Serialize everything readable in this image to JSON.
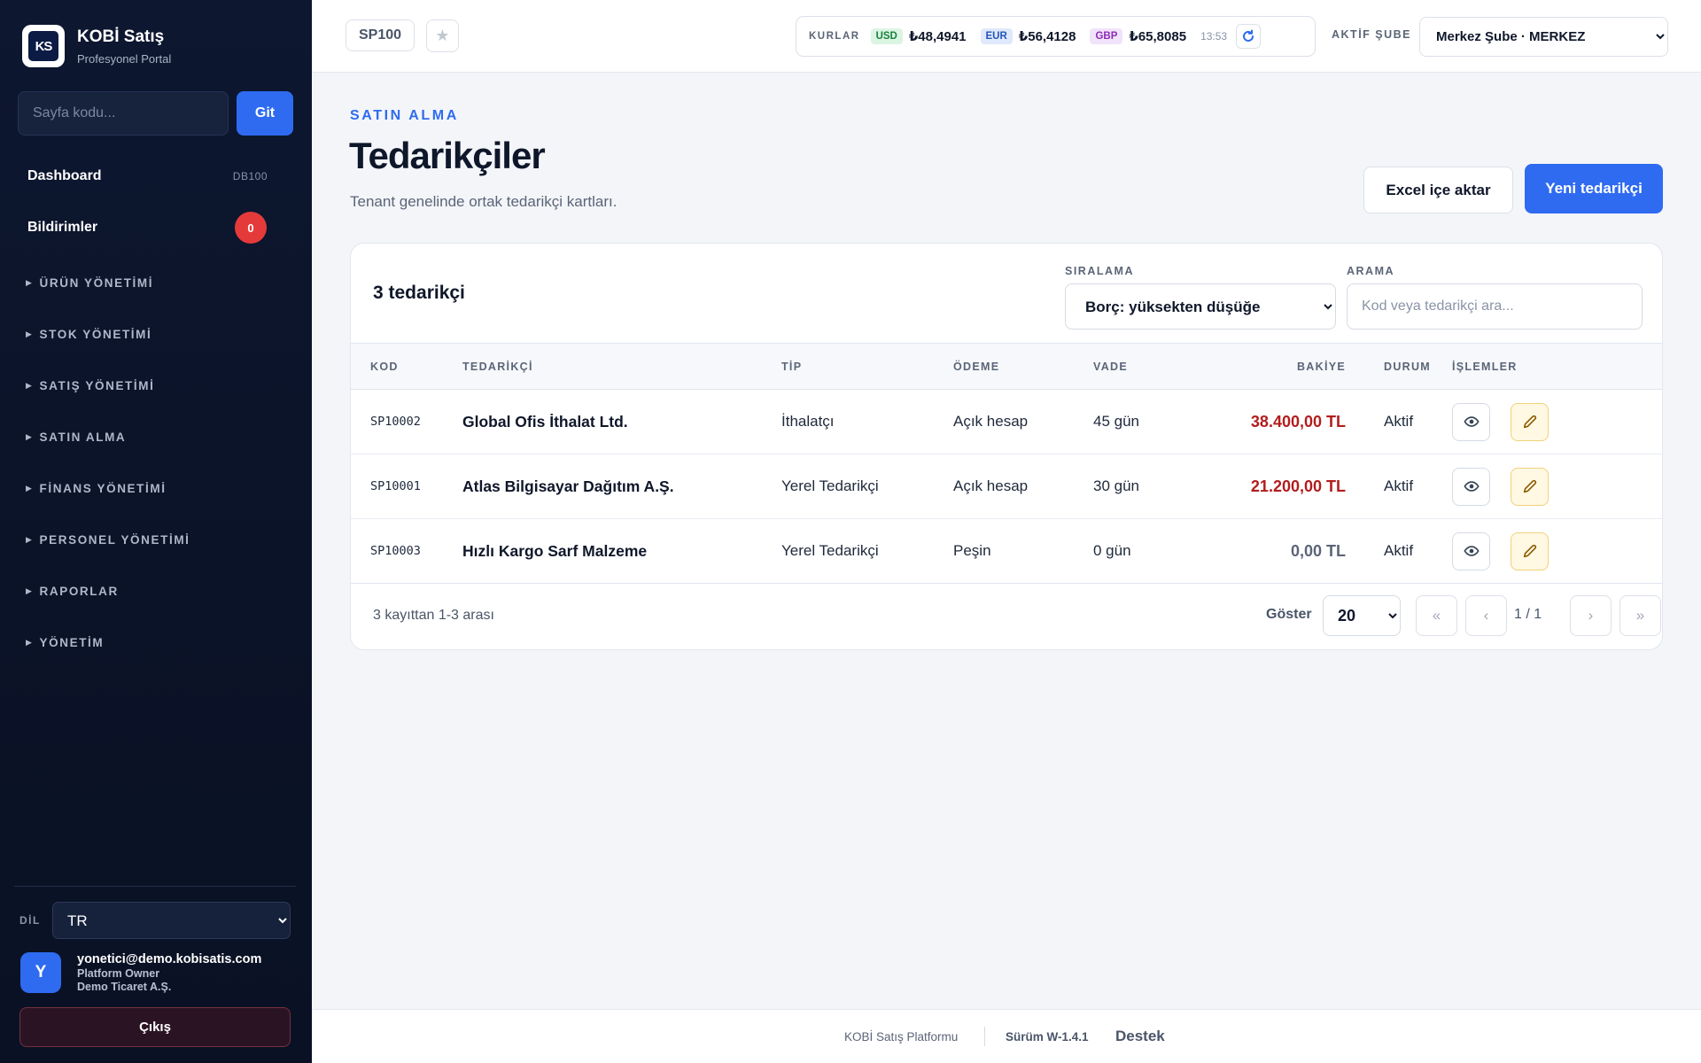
{
  "brand": {
    "logo_text": "KS",
    "title": "KOBİ Satış",
    "subtitle": "Profesyonel Portal"
  },
  "page_jump": {
    "placeholder": "Sayfa kodu...",
    "button": "Git"
  },
  "nav": {
    "dashboard": {
      "label": "Dashboard",
      "code": "DB100"
    },
    "notifications": {
      "label": "Bildirimler",
      "count": "0"
    },
    "groups": [
      "ÜRÜN YÖNETİMİ",
      "STOK YÖNETİMİ",
      "SATIŞ YÖNETİMİ",
      "SATIN ALMA",
      "FİNANS YÖNETİMİ",
      "PERSONEL YÖNETİMİ",
      "RAPORLAR",
      "YÖNETİM"
    ]
  },
  "language": {
    "label": "DİL",
    "value": "TR"
  },
  "user": {
    "initial": "Y",
    "email": "yonetici@demo.kobisatis.com",
    "role": "Platform Owner",
    "company": "Demo Ticaret A.Ş."
  },
  "logout": "Çıkış",
  "topbar": {
    "page_code": "SP100",
    "rates_label": "KURLAR",
    "rates": [
      {
        "code": "USD",
        "value": "₺48,4941",
        "color": "#16803d"
      },
      {
        "code": "EUR",
        "value": "₺56,4128",
        "color": "#2455b8"
      },
      {
        "code": "GBP",
        "value": "₺65,8085",
        "color": "#8c2cb8"
      }
    ],
    "rates_time": "13:53",
    "branch_label": "AKTİF ŞUBE",
    "branch_value": "Merkez Şube · MERKEZ"
  },
  "header": {
    "eyebrow": "SATIN ALMA",
    "title": "Tedarikçiler",
    "subtitle": "Tenant genelinde ortak tedarikçi kartları.",
    "import_button": "Excel içe aktar",
    "new_button": "Yeni tedarikçi"
  },
  "card": {
    "count": "3 tedarikçi",
    "sort_label": "SIRALAMA",
    "sort_value": "Borç: yüksekten düşüğe",
    "search_label": "ARAMA",
    "search_placeholder": "Kod veya tedarikçi ara..."
  },
  "table": {
    "columns": [
      "KOD",
      "TEDARİKÇİ",
      "TİP",
      "ÖDEME",
      "VADE",
      "BAKİYE",
      "DURUM",
      "İŞLEMLER"
    ],
    "rows": [
      {
        "kod": "SP10002",
        "name": "Global Ofis İthalat Ltd.",
        "tip": "İthalatçı",
        "odeme": "Açık hesap",
        "vade": "45 gün",
        "bakiye": "38.400,00 TL",
        "durum": "Aktif",
        "debt": true
      },
      {
        "kod": "SP10001",
        "name": "Atlas Bilgisayar Dağıtım A.Ş.",
        "tip": "Yerel Tedarikçi",
        "odeme": "Açık hesap",
        "vade": "30 gün",
        "bakiye": "21.200,00 TL",
        "durum": "Aktif",
        "debt": true
      },
      {
        "kod": "SP10003",
        "name": "Hızlı Kargo Sarf Malzeme",
        "tip": "Yerel Tedarikçi",
        "odeme": "Peşin",
        "vade": "0 gün",
        "bakiye": "0,00 TL",
        "durum": "Aktif",
        "debt": false
      }
    ]
  },
  "pagination": {
    "info": "3 kayıttan 1-3 arası",
    "show_label": "Göster",
    "page_size": "20",
    "page": "1 / 1",
    "first": "«",
    "prev": "‹",
    "next": "›",
    "last": "»"
  },
  "footer": {
    "platform": "KOBİ Satış Platformu",
    "version": "Sürüm W-1.4.1",
    "support": "Destek"
  }
}
